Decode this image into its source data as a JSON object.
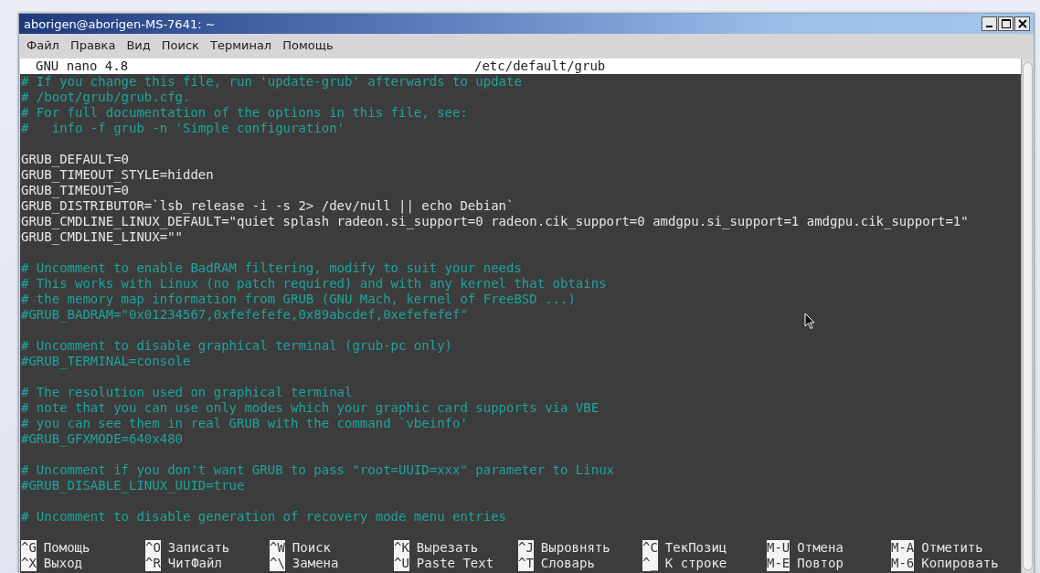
{
  "window": {
    "title": "aborigen@aborigen-MS-7641: ~"
  },
  "menu": [
    "Файл",
    "Правка",
    "Вид",
    "Поиск",
    "Терминал",
    "Помощь"
  ],
  "nano_header": {
    "version": "GNU nano 4.8",
    "file": "/etc/default/grub"
  },
  "lines": [
    {
      "kind": "comment",
      "text": "# If you change this file, run 'update-grub' afterwards to update"
    },
    {
      "kind": "comment",
      "text": "# /boot/grub/grub.cfg."
    },
    {
      "kind": "comment",
      "text": "# For full documentation of the options in this file, see:"
    },
    {
      "kind": "comment",
      "text": "#   info -f grub -n 'Simple configuration'"
    },
    {
      "kind": "blank"
    },
    {
      "kind": "code",
      "text": "GRUB_DEFAULT=0"
    },
    {
      "kind": "code",
      "text": "GRUB_TIMEOUT_STYLE=hidden"
    },
    {
      "kind": "code",
      "text": "GRUB_TIMEOUT=0"
    },
    {
      "kind": "code",
      "text": "GRUB_DISTRIBUTOR=`lsb_release -i -s 2> /dev/null || echo Debian`"
    },
    {
      "kind": "code",
      "text": "GRUB_CMDLINE_LINUX_DEFAULT=\"quiet splash radeon.si_support=0 radeon.cik_support=0 amdgpu.si_support=1 amdgpu.cik_support=1\""
    },
    {
      "kind": "code",
      "text": "GRUB_CMDLINE_LINUX=\"\""
    },
    {
      "kind": "blank"
    },
    {
      "kind": "comment",
      "text": "# Uncomment to enable BadRAM filtering, modify to suit your needs"
    },
    {
      "kind": "comment",
      "text": "# This works with Linux (no patch required) and with any kernel that obtains"
    },
    {
      "kind": "comment",
      "text": "# the memory map information from GRUB (GNU Mach, kernel of FreeBSD ...)"
    },
    {
      "kind": "comment",
      "text": "#GRUB_BADRAM=\"0x01234567,0xfefefefe,0x89abcdef,0xefefefef\""
    },
    {
      "kind": "blank"
    },
    {
      "kind": "comment",
      "text": "# Uncomment to disable graphical terminal (grub-pc only)"
    },
    {
      "kind": "comment",
      "text": "#GRUB_TERMINAL=console"
    },
    {
      "kind": "blank"
    },
    {
      "kind": "comment",
      "text": "# The resolution used on graphical terminal"
    },
    {
      "kind": "comment",
      "text": "# note that you can use only modes which your graphic card supports via VBE"
    },
    {
      "kind": "comment",
      "text": "# you can see them in real GRUB with the command `vbeinfo'"
    },
    {
      "kind": "comment",
      "text": "#GRUB_GFXMODE=640x480"
    },
    {
      "kind": "blank"
    },
    {
      "kind": "comment",
      "text": "# Uncomment if you don't want GRUB to pass \"root=UUID=xxx\" parameter to Linux"
    },
    {
      "kind": "comment",
      "text": "#GRUB_DISABLE_LINUX_UUID=true"
    },
    {
      "kind": "blank"
    },
    {
      "kind": "comment",
      "text": "# Uncomment to disable generation of recovery mode menu entries"
    }
  ],
  "shortcuts": [
    {
      "key": "^G",
      "label": "Помощь"
    },
    {
      "key": "^O",
      "label": "Записать"
    },
    {
      "key": "^W",
      "label": "Поиск"
    },
    {
      "key": "^K",
      "label": "Вырезать"
    },
    {
      "key": "^J",
      "label": "Выровнять"
    },
    {
      "key": "^C",
      "label": "ТекПозиц"
    },
    {
      "key": "M-U",
      "label": "Отмена"
    },
    {
      "key": "M-A",
      "label": "Отметить"
    },
    {
      "key": "^X",
      "label": "Выход"
    },
    {
      "key": "^R",
      "label": "ЧитФайл"
    },
    {
      "key": "^\\",
      "label": "Замена"
    },
    {
      "key": "^U",
      "label": "Paste Text"
    },
    {
      "key": "^T",
      "label": "Словарь"
    },
    {
      "key": "^_",
      "label": "К строке"
    },
    {
      "key": "M-E",
      "label": "Повтор"
    },
    {
      "key": "M-6",
      "label": "Копировать"
    }
  ]
}
